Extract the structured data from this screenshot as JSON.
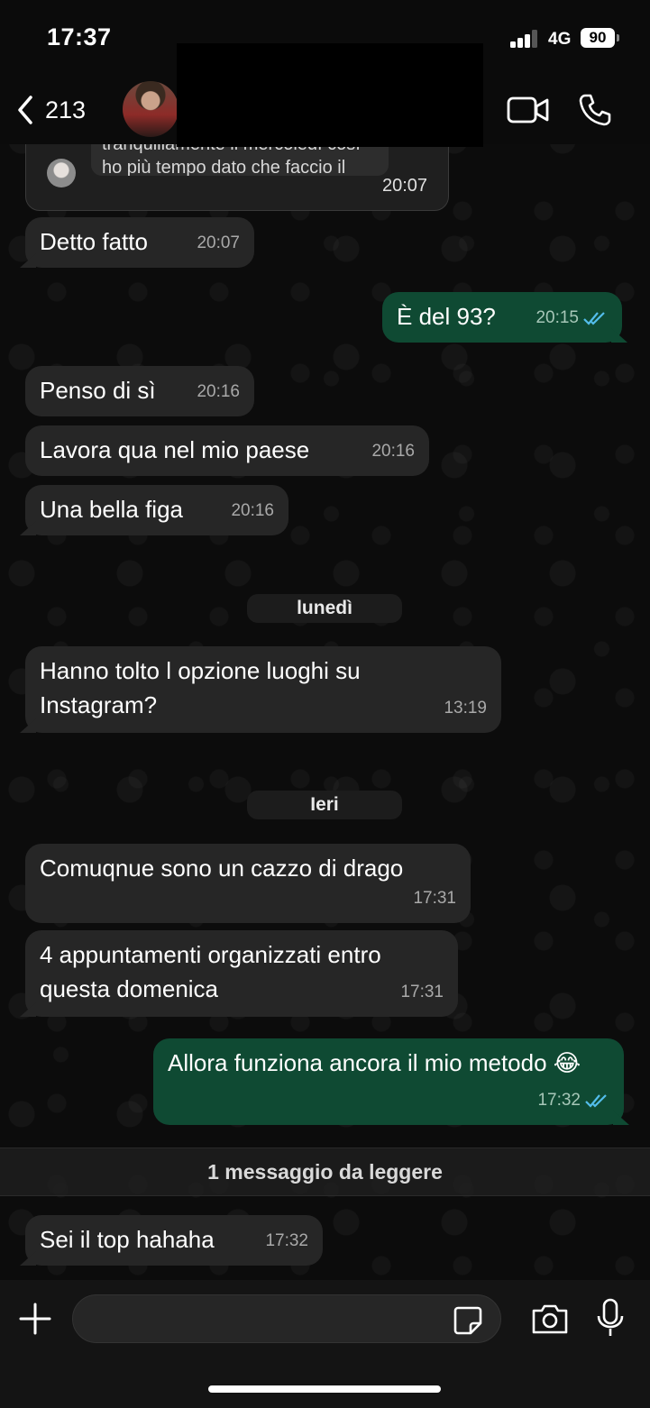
{
  "status_bar": {
    "time": "17:37",
    "network": "4G",
    "battery": "90"
  },
  "header": {
    "back_count": "213"
  },
  "quoted": {
    "text": "tranquillamente il mercoledì così ho più tempo dato che faccio il riposo..",
    "time": "20:07"
  },
  "messages": [
    {
      "dir": "in",
      "text": "Detto fatto",
      "time": "20:07"
    },
    {
      "dir": "out",
      "text": "È del 93?",
      "time": "20:15"
    },
    {
      "dir": "in",
      "text": "Penso di sì",
      "time": "20:16"
    },
    {
      "dir": "in",
      "text": "Lavora qua nel mio paese",
      "time": "20:16"
    },
    {
      "dir": "in",
      "text": "Una bella figa",
      "time": "20:16"
    },
    {
      "dir": "in",
      "text": "Hanno tolto l opzione luoghi su Instagram?",
      "time": "13:19"
    },
    {
      "dir": "in",
      "text": "Comuqnue sono un cazzo di drago",
      "time": "17:31"
    },
    {
      "dir": "in",
      "text": "4 appuntamenti organizzati entro questa domenica",
      "time": "17:31"
    },
    {
      "dir": "out",
      "text": "Allora funziona ancora il mio metodo 😂",
      "time": "17:32"
    },
    {
      "dir": "in",
      "text": "Sei il top hahaha",
      "time": "17:32"
    }
  ],
  "date_separators": [
    "lunedì",
    "Ieri"
  ],
  "unread_banner": "1 messaggio da leggere",
  "input": {
    "value": "",
    "placeholder": ""
  },
  "colors": {
    "incoming_bubble": "#262626",
    "outgoing_bubble": "#0f4a33",
    "read_ticks": "#53bdeb"
  }
}
